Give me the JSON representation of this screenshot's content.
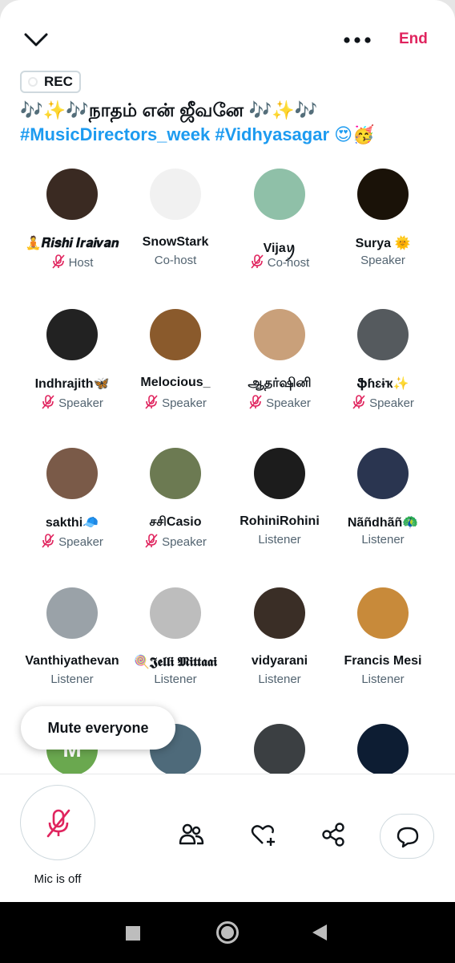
{
  "header": {
    "end_label": "End",
    "rec_label": "REC",
    "title_line1": "🎶✨🎶நாதம் என் ஜீவனே 🎶✨🎶",
    "title_line2": "#MusicDirectors_week #Vidhyasagar 😍🥳"
  },
  "participants": [
    {
      "name": "🧘𝑹𝒊𝒔𝒉𝒊 𝑰𝒓𝒂𝒊𝒗𝒂𝒏",
      "role": "Host",
      "muted": true,
      "avatar_color": "#3a2a22"
    },
    {
      "name": "SnowStark",
      "role": "Co-host",
      "muted": false,
      "avatar_color": "#f1f1f1"
    },
    {
      "name": "Vijaꪗ",
      "role": "Co-host",
      "muted": true,
      "avatar_color": "#8fc0a8"
    },
    {
      "name": "Surya 🌞",
      "role": "Speaker",
      "muted": false,
      "avatar_color": "#1a1208"
    },
    {
      "name": "Indhrajith🦋",
      "role": "Speaker",
      "muted": true,
      "avatar_color": "#222222"
    },
    {
      "name": "Melocious_",
      "role": "Speaker",
      "muted": true,
      "avatar_color": "#8a5a2c"
    },
    {
      "name": "ஆதர்ஷினி",
      "role": "Speaker",
      "muted": true,
      "avatar_color": "#c9a07a"
    },
    {
      "name": "ֆɦɛɨҡ✨",
      "role": "Speaker",
      "muted": true,
      "avatar_color": "#555a5e"
    },
    {
      "name": "sakthi🧢",
      "role": "Speaker",
      "muted": true,
      "avatar_color": "#7a5a48"
    },
    {
      "name": "சசிCasio",
      "role": "Speaker",
      "muted": true,
      "avatar_color": "#6c7a52"
    },
    {
      "name": "RohiniRohini",
      "role": "Listener",
      "muted": false,
      "avatar_color": "#1c1c1c"
    },
    {
      "name": "Nãñdhãñ🦚",
      "role": "Listener",
      "muted": false,
      "avatar_color": "#2a3550"
    },
    {
      "name": "Vanthiyathevan",
      "role": "Listener",
      "muted": false,
      "avatar_color": "#9aa2a8"
    },
    {
      "name": "🍭𝕵𝖊𝖑𝖑𝖎 𝕸𝖎𝖙𝖙𝖆𝖆𝖎",
      "role": "Listener",
      "muted": false,
      "avatar_color": "#bdbdbd"
    },
    {
      "name": "vidyarani",
      "role": "Listener",
      "muted": false,
      "avatar_color": "#3a2e26"
    },
    {
      "name": "Francis Mesi",
      "role": "Listener",
      "muted": false,
      "avatar_color": "#c88a3a"
    },
    {
      "name": "",
      "role": "",
      "muted": false,
      "avatar_color": "#6aa84f",
      "initial": "M"
    },
    {
      "name": "",
      "role": "",
      "muted": false,
      "avatar_color": "#4e6a7a"
    },
    {
      "name": "",
      "role": "",
      "muted": false,
      "avatar_color": "#3b3f42"
    },
    {
      "name": "",
      "role": "",
      "muted": false,
      "avatar_color": "#0d1d33"
    }
  ],
  "toast": {
    "mute_everyone_label": "Mute everyone"
  },
  "bottom_bar": {
    "mic_status_label": "Mic is off"
  },
  "colors": {
    "accent": "#1d9bf0",
    "end_red": "#e0245e",
    "muted_mic": "#e0245e",
    "muted_text": "#536471"
  },
  "icons": [
    "chevron-down-icon",
    "more-icon",
    "mic-off-icon",
    "people-icon",
    "heart-plus-icon",
    "share-icon",
    "chat-bubble-icon"
  ]
}
